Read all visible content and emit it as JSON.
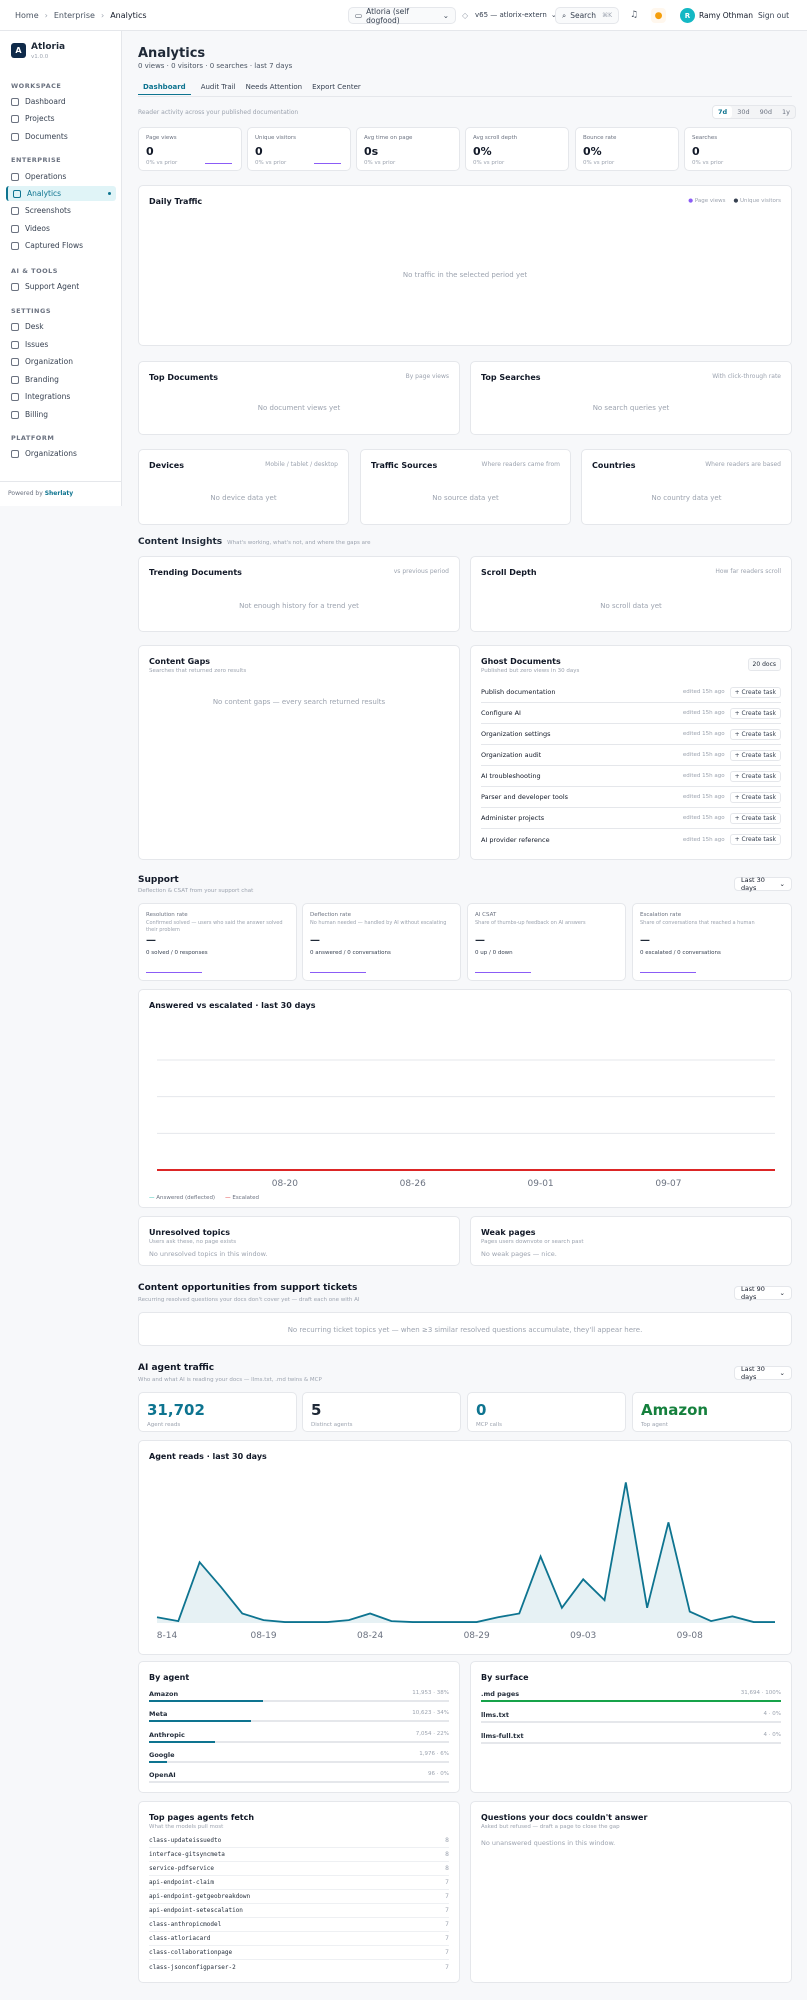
{
  "topbar": {
    "crumbs": [
      "Home",
      "Enterprise",
      "Analytics"
    ],
    "workspace": "Atloria (self dogfood)",
    "version": "v65 — atlorix-extern",
    "search": "Search",
    "search_kbd": "⌘K",
    "user_name": "Ramy Othman",
    "user_initial": "R",
    "signout": "Sign out"
  },
  "sidebar": {
    "org": "Atloria",
    "org_initial": "A",
    "org_version": "v1.0.0",
    "sections": [
      {
        "title": "WORKSPACE",
        "items": [
          "Dashboard",
          "Projects",
          "Documents"
        ]
      },
      {
        "title": "ENTERPRISE",
        "items": [
          "Operations",
          "Analytics",
          "Screenshots",
          "Videos",
          "Captured Flows"
        ]
      },
      {
        "title": "AI & TOOLS",
        "items": [
          "Support Agent"
        ]
      },
      {
        "title": "SETTINGS",
        "items": [
          "Desk",
          "Issues",
          "Organization",
          "Branding",
          "Integrations",
          "Billing"
        ]
      },
      {
        "title": "PLATFORM",
        "items": [
          "Organizations"
        ]
      }
    ],
    "powered_label": "Powered by",
    "powered_brand": "Sherlaty"
  },
  "header": {
    "title": "Analytics",
    "meta": "0 views · 0 visitors · 0 searches · last 7 days",
    "tabs": [
      "Dashboard",
      "Audit Trail",
      "Needs Attention",
      "Export Center"
    ],
    "subtitle": "Reader activity across your published documentation",
    "ranges": [
      "7d",
      "30d",
      "90d",
      "1y"
    ]
  },
  "stats": [
    {
      "label": "Page views",
      "value": "0",
      "prior": "0% vs prior"
    },
    {
      "label": "Unique visitors",
      "value": "0",
      "prior": "0% vs prior"
    },
    {
      "label": "Avg time on page",
      "value": "0s",
      "prior": "0% vs prior"
    },
    {
      "label": "Avg scroll depth",
      "value": "0%",
      "prior": "0% vs prior"
    },
    {
      "label": "Bounce rate",
      "value": "0%",
      "prior": "0% vs prior"
    },
    {
      "label": "Searches",
      "value": "0",
      "prior": "0% vs prior"
    }
  ],
  "daily": {
    "title": "Daily Traffic",
    "legend": [
      "Page views",
      "Unique visitors"
    ],
    "empty": "No traffic in the selected period yet"
  },
  "top_docs": {
    "title": "Top Documents",
    "sub": "By page views",
    "empty": "No document views yet"
  },
  "top_searches": {
    "title": "Top Searches",
    "sub": "With click-through rate",
    "empty": "No search queries yet"
  },
  "devices": {
    "title": "Devices",
    "sub": "Mobile / tablet / desktop",
    "empty": "No device data yet"
  },
  "sources": {
    "title": "Traffic Sources",
    "sub": "Where readers came from",
    "empty": "No source data yet"
  },
  "countries": {
    "title": "Countries",
    "sub": "Where readers are based",
    "empty": "No country data yet"
  },
  "insights": {
    "title": "Content Insights",
    "sub": "What's working, what's not, and where the gaps are"
  },
  "trending": {
    "title": "Trending Documents",
    "sub": "vs previous period",
    "empty": "Not enough history for a trend yet"
  },
  "scroll": {
    "title": "Scroll Depth",
    "sub": "How far readers scroll",
    "empty": "No scroll data yet"
  },
  "gaps": {
    "title": "Content Gaps",
    "sub": "Searches that returned zero results",
    "empty": "No content gaps — every search returned results"
  },
  "ghost": {
    "title": "Ghost Documents",
    "sub": "Published but zero views in 30 days",
    "badge": "20 docs",
    "edited": "edited 15h ago",
    "btn": "+ Create task",
    "docs": [
      "Publish documentation",
      "Configure AI",
      "Organization settings",
      "Organization audit",
      "AI troubleshooting",
      "Parser and developer tools",
      "Administer projects",
      "AI provider reference"
    ]
  },
  "support": {
    "title": "Support",
    "sub": "Deflection & CSAT from your support chat",
    "range": "Last 30 days",
    "cards": [
      {
        "label": "Resolution rate",
        "desc": "Confirmed solved — users who said the answer solved their problem",
        "value": "—",
        "note": "0 solved / 0 responses"
      },
      {
        "label": "Deflection rate",
        "desc": "No human needed — handled by AI without escalating",
        "value": "—",
        "note": "0 answered / 0 conversations"
      },
      {
        "label": "AI CSAT",
        "desc": "Share of thumbs-up feedback on AI answers",
        "value": "—",
        "note": "0 up / 0 down"
      },
      {
        "label": "Escalation rate",
        "desc": "Share of conversations that reached a human",
        "value": "—",
        "note": "0 escalated / 0 conversations"
      }
    ]
  },
  "chart_data": [
    {
      "type": "line",
      "title": "Answered vs escalated · last 30 days",
      "x_ticks": [
        "08-20",
        "08-26",
        "09-01",
        "09-07"
      ],
      "x": [
        "08-14",
        "08-15",
        "08-16",
        "08-17",
        "08-18",
        "08-19",
        "08-20",
        "08-21",
        "08-22",
        "08-23",
        "08-24",
        "08-25",
        "08-26",
        "08-27",
        "08-28",
        "08-29",
        "08-30",
        "08-31",
        "09-01",
        "09-02",
        "09-03",
        "09-04",
        "09-05",
        "09-06",
        "09-07",
        "09-08",
        "09-09",
        "09-10",
        "09-11",
        "09-12"
      ],
      "series": [
        {
          "name": "Answered (deflected)",
          "color": "#14b8a6",
          "values": [
            0,
            0,
            0,
            0,
            0,
            0,
            0,
            0,
            0,
            0,
            0,
            0,
            0,
            0,
            0,
            0,
            0,
            0,
            0,
            0,
            0,
            0,
            0,
            0,
            0,
            0,
            0,
            0,
            0,
            0
          ]
        },
        {
          "name": "Escalated",
          "color": "#dc2626",
          "values": [
            0,
            0,
            0,
            0,
            0,
            0,
            0,
            0,
            0,
            0,
            0,
            0,
            0,
            0,
            0,
            0,
            0,
            0,
            0,
            0,
            0,
            0,
            0,
            0,
            0,
            0,
            0,
            0,
            0,
            0
          ]
        }
      ],
      "ylim": [
        0,
        3
      ]
    },
    {
      "type": "area",
      "title": "Agent reads · last 30 days",
      "x_ticks": [
        "8-14",
        "08-19",
        "08-24",
        "08-29",
        "09-03",
        "09-08"
      ],
      "x": [
        "08-14",
        "08-15",
        "08-16",
        "08-17",
        "08-18",
        "08-19",
        "08-20",
        "08-21",
        "08-22",
        "08-23",
        "08-24",
        "08-25",
        "08-26",
        "08-27",
        "08-28",
        "08-29",
        "08-30",
        "08-31",
        "09-01",
        "09-02",
        "09-03",
        "09-04",
        "09-05",
        "09-06",
        "09-07",
        "09-08",
        "09-09",
        "09-10",
        "09-11",
        "09-12"
      ],
      "series": [
        {
          "color": "#0e7490",
          "values": [
            300,
            100,
            3200,
            1900,
            500,
            150,
            50,
            50,
            50,
            150,
            500,
            100,
            50,
            50,
            50,
            50,
            300,
            500,
            3500,
            800,
            2300,
            1200,
            7400,
            800,
            5300,
            600,
            100,
            350,
            50,
            50
          ]
        }
      ],
      "ylim": [
        0,
        8000
      ]
    }
  ],
  "answered_card": {
    "title": "Answered vs escalated · last 30 days"
  },
  "unresolved": {
    "title": "Unresolved topics",
    "sub": "Users ask these, no page exists",
    "empty": "No unresolved topics in this window."
  },
  "weak": {
    "title": "Weak pages",
    "sub": "Pages users downvote or search past",
    "empty": "No weak pages — nice."
  },
  "opps": {
    "title": "Content opportunities from support tickets",
    "sub": "Recurring resolved questions your docs don't cover yet — draft each one with AI",
    "range": "Last 90 days",
    "empty": "No recurring ticket topics yet — when ≥3 similar resolved questions accumulate, they'll appear here."
  },
  "ai": {
    "title": "AI agent traffic",
    "sub": "Who and what AI is reading your docs — llms.txt, .md twins & MCP",
    "range": "Last 30 days",
    "stats": [
      {
        "value": "31,702",
        "label": "Agent reads",
        "color": "#0e7490"
      },
      {
        "value": "5",
        "label": "Distinct agents",
        "color": "#111827"
      },
      {
        "value": "0",
        "label": "MCP calls",
        "color": "#0e7490"
      },
      {
        "value": "Amazon",
        "label": "Top agent",
        "color": "#15803d"
      }
    ],
    "chart_title": "Agent reads · last 30 days"
  },
  "by_agent": {
    "title": "By agent",
    "rows": [
      {
        "name": "Amazon",
        "value": "11,953 · 38%",
        "pct": 38
      },
      {
        "name": "Meta",
        "value": "10,623 · 34%",
        "pct": 34
      },
      {
        "name": "Anthropic",
        "value": "7,054 · 22%",
        "pct": 22
      },
      {
        "name": "Google",
        "value": "1,976 · 6%",
        "pct": 6
      },
      {
        "name": "OpenAI",
        "value": "96 · 0%",
        "pct": 0
      }
    ]
  },
  "by_surface": {
    "title": "By surface",
    "rows": [
      {
        "name": ".md pages",
        "value": "31,694 · 100%",
        "pct": 100
      },
      {
        "name": "llms.txt",
        "value": "4 · 0%",
        "pct": 0
      },
      {
        "name": "llms-full.txt",
        "value": "4 · 0%",
        "pct": 0
      }
    ]
  },
  "fetch": {
    "title": "Top pages agents fetch",
    "sub": "What the models pull most",
    "rows": [
      {
        "path": "class-updateissuedto",
        "count": "8"
      },
      {
        "path": "interface-gitsyncmeta",
        "count": "8"
      },
      {
        "path": "service-pdfservice",
        "count": "8"
      },
      {
        "path": "api-endpoint-claim",
        "count": "7"
      },
      {
        "path": "api-endpoint-getgeobreakdown",
        "count": "7"
      },
      {
        "path": "api-endpoint-setescalation",
        "count": "7"
      },
      {
        "path": "class-anthropicmodel",
        "count": "7"
      },
      {
        "path": "class-atloriacard",
        "count": "7"
      },
      {
        "path": "class-collaborationpage",
        "count": "7"
      },
      {
        "path": "class-jsonconfigparser-2",
        "count": "7"
      }
    ]
  },
  "questions": {
    "title": "Questions your docs couldn't answer",
    "sub": "Asked but refused — draft a page to close the gap",
    "empty": "No unanswered questions in this window."
  }
}
